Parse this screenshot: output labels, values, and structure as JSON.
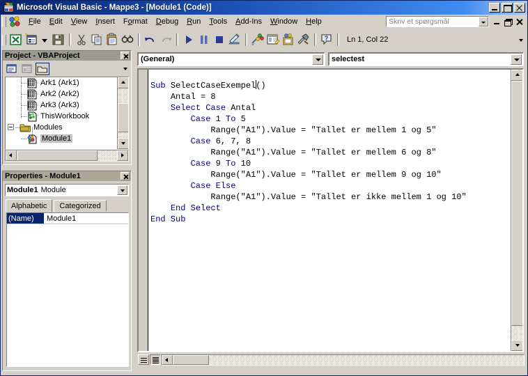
{
  "window": {
    "title": "Microsoft Visual Basic - Mappe3 - [Module1 (Code)]",
    "icon": "vb-app-icon",
    "buttons": {
      "minimize": "Minimize",
      "maximize": "Maximize",
      "close": "Close"
    }
  },
  "menu": {
    "items": [
      {
        "label": "File",
        "accel": "F"
      },
      {
        "label": "Edit",
        "accel": "E"
      },
      {
        "label": "View",
        "accel": "V"
      },
      {
        "label": "Insert",
        "accel": "I"
      },
      {
        "label": "Format",
        "accel": "o"
      },
      {
        "label": "Debug",
        "accel": "D"
      },
      {
        "label": "Run",
        "accel": "R"
      },
      {
        "label": "Tools",
        "accel": "T"
      },
      {
        "label": "Add-Ins",
        "accel": "A"
      },
      {
        "label": "Window",
        "accel": "W"
      },
      {
        "label": "Help",
        "accel": "H"
      }
    ],
    "ask_box": {
      "placeholder": "Skriv et spørgsmål",
      "value": ""
    },
    "mdi_buttons": {
      "minimize": "Minimize Window",
      "restore": "Restore Window",
      "close": "Close Window"
    }
  },
  "toolbar": {
    "buttons": [
      {
        "name": "view-excel",
        "tooltip": "View Microsoft Excel"
      },
      {
        "name": "insert-userform",
        "tooltip": "Insert UserForm"
      },
      {
        "name": "save",
        "tooltip": "Save Mappe3"
      },
      {
        "name": "cut",
        "tooltip": "Cut"
      },
      {
        "name": "copy",
        "tooltip": "Copy"
      },
      {
        "name": "paste",
        "tooltip": "Paste"
      },
      {
        "name": "find",
        "tooltip": "Find"
      },
      {
        "name": "undo",
        "tooltip": "Undo"
      },
      {
        "name": "redo",
        "tooltip": "Redo"
      },
      {
        "name": "run",
        "tooltip": "Run Sub/UserForm"
      },
      {
        "name": "break",
        "tooltip": "Break"
      },
      {
        "name": "reset",
        "tooltip": "Reset"
      },
      {
        "name": "design-mode",
        "tooltip": "Design Mode"
      },
      {
        "name": "project-explorer",
        "tooltip": "Project Explorer"
      },
      {
        "name": "properties-window",
        "tooltip": "Properties Window"
      },
      {
        "name": "object-browser",
        "tooltip": "Object Browser"
      },
      {
        "name": "toolbox",
        "tooltip": "Toolbox"
      },
      {
        "name": "help",
        "tooltip": "Microsoft Visual Basic Help"
      }
    ],
    "status": "Ln 1, Col 22"
  },
  "project_explorer": {
    "title": "Project - VBAProject",
    "toolbar": [
      {
        "name": "view-code",
        "label": "View Code"
      },
      {
        "name": "view-object",
        "label": "View Object"
      },
      {
        "name": "toggle-folders",
        "label": "Toggle Folders"
      }
    ],
    "tree": [
      {
        "label": "Ark1 (Ark1)",
        "icon": "worksheet-icon",
        "indent": 2,
        "selected": false
      },
      {
        "label": "Ark2 (Ark2)",
        "icon": "worksheet-icon",
        "indent": 2,
        "selected": false
      },
      {
        "label": "Ark3 (Ark3)",
        "icon": "worksheet-icon",
        "indent": 2,
        "selected": false
      },
      {
        "label": "ThisWorkbook",
        "icon": "workbook-icon",
        "indent": 2,
        "selected": false
      },
      {
        "label": "Modules",
        "icon": "folder-icon",
        "indent": 1,
        "selected": false,
        "expander": "collapse"
      },
      {
        "label": "Module1",
        "icon": "module-icon",
        "indent": 2,
        "selected": true
      }
    ]
  },
  "properties": {
    "title": "Properties - Module1",
    "object_name": "Module1",
    "object_type": "Module",
    "tabs": [
      {
        "label": "Alphabetic",
        "active": true
      },
      {
        "label": "Categorized",
        "active": false
      }
    ],
    "rows": [
      {
        "key": "(Name)",
        "value": "Module1"
      }
    ]
  },
  "code_window": {
    "object_combo": "(General)",
    "procedure_combo": "selectest",
    "view_buttons": [
      {
        "name": "procedure-view",
        "label": "Procedure View",
        "pressed": false
      },
      {
        "name": "full-module-view",
        "label": "Full Module View",
        "pressed": true
      }
    ],
    "lines": [
      {
        "indent": 0,
        "parts": [
          {
            "t": "kw",
            "s": "Sub "
          },
          {
            "t": "id",
            "s": "SelectCaseExempel"
          },
          {
            "t": "caret",
            "s": ""
          },
          {
            "t": "id",
            "s": "()"
          }
        ]
      },
      {
        "indent": 1,
        "parts": [
          {
            "t": "id",
            "s": "Antal = 8"
          }
        ]
      },
      {
        "indent": 1,
        "parts": [
          {
            "t": "kw",
            "s": "Select Case "
          },
          {
            "t": "id",
            "s": "Antal"
          }
        ]
      },
      {
        "indent": 2,
        "parts": [
          {
            "t": "kw",
            "s": "Case "
          },
          {
            "t": "id",
            "s": "1 "
          },
          {
            "t": "kw",
            "s": "To "
          },
          {
            "t": "id",
            "s": "5"
          }
        ]
      },
      {
        "indent": 3,
        "parts": [
          {
            "t": "id",
            "s": "Range(\"A1\").Value = \"Tallet er mellem 1 og 5\""
          }
        ]
      },
      {
        "indent": 2,
        "parts": [
          {
            "t": "kw",
            "s": "Case "
          },
          {
            "t": "id",
            "s": "6, 7, 8"
          }
        ]
      },
      {
        "indent": 3,
        "parts": [
          {
            "t": "id",
            "s": "Range(\"A1\").Value = \"Tallet er mellem 6 og 8\""
          }
        ]
      },
      {
        "indent": 2,
        "parts": [
          {
            "t": "kw",
            "s": "Case "
          },
          {
            "t": "id",
            "s": "9 "
          },
          {
            "t": "kw",
            "s": "To "
          },
          {
            "t": "id",
            "s": "10"
          }
        ]
      },
      {
        "indent": 3,
        "parts": [
          {
            "t": "id",
            "s": "Range(\"A1\").Value = \"Tallet er mellem 9 og 10\""
          }
        ]
      },
      {
        "indent": 2,
        "parts": [
          {
            "t": "kw",
            "s": "Case Else"
          }
        ]
      },
      {
        "indent": 3,
        "parts": [
          {
            "t": "id",
            "s": "Range(\"A1\").Value = \"Tallet er ikke mellem 1 og 10\""
          }
        ]
      },
      {
        "indent": 1,
        "parts": [
          {
            "t": "kw",
            "s": "End Select"
          }
        ]
      },
      {
        "indent": 0,
        "parts": [
          {
            "t": "kw",
            "s": "End Sub"
          }
        ]
      }
    ]
  },
  "colors": {
    "title_active_start": "#0a246a",
    "title_active_end": "#a8c8f0",
    "face": "#d4d0c8",
    "keyword": "#00007f",
    "panel_title": "#9a9a8e",
    "selection": "#0a246a"
  }
}
